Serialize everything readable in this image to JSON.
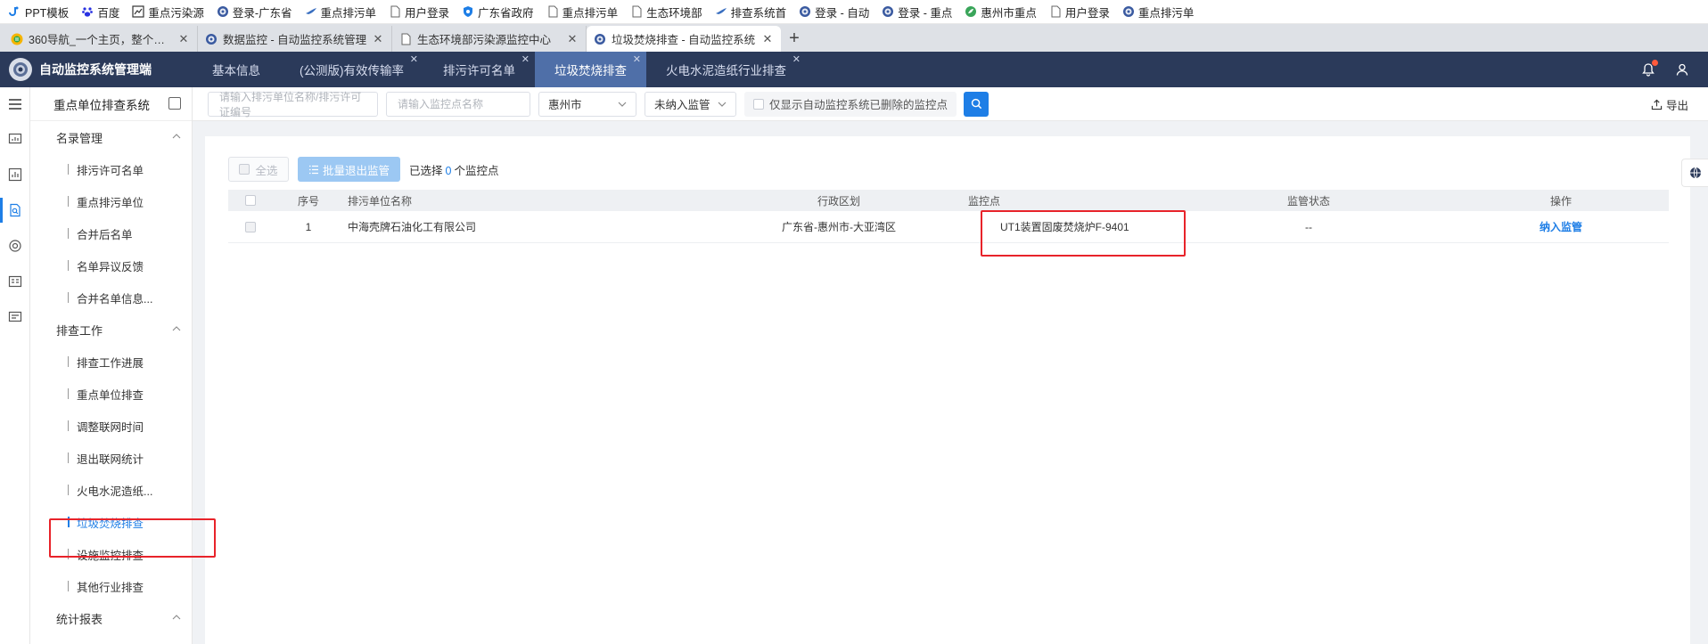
{
  "bookmarks": [
    {
      "label": "PPT模板",
      "icon": "blue-logo-icon"
    },
    {
      "label": "百度",
      "icon": "baidu-paw-icon"
    },
    {
      "label": "重点污染源",
      "icon": "chart-icon"
    },
    {
      "label": "登录-广东省",
      "icon": "emblem-icon"
    },
    {
      "label": "重点排污单",
      "icon": "bird-icon"
    },
    {
      "label": "用户登录",
      "icon": "page-icon"
    },
    {
      "label": "广东省政府",
      "icon": "shield-blue-icon"
    },
    {
      "label": "重点排污单",
      "icon": "page-icon"
    },
    {
      "label": "生态环境部",
      "icon": "page-icon"
    },
    {
      "label": "排查系统首",
      "icon": "bird-icon"
    },
    {
      "label": "登录 - 自动",
      "icon": "emblem-icon"
    },
    {
      "label": "登录 - 重点",
      "icon": "emblem-icon"
    },
    {
      "label": "惠州市重点",
      "icon": "leaf-icon"
    },
    {
      "label": "用户登录",
      "icon": "page-icon"
    },
    {
      "label": "重点排污单",
      "icon": "emblem-icon"
    }
  ],
  "tabs": [
    {
      "title": "360导航_一个主页，整个世界",
      "icon": "360-icon",
      "active": false
    },
    {
      "title": "数据监控 - 自动监控系统管理",
      "icon": "emblem-icon",
      "active": false
    },
    {
      "title": "生态环境部污染源监控中心",
      "icon": "page-icon",
      "active": false
    },
    {
      "title": "垃圾焚烧排查 - 自动监控系统",
      "icon": "emblem-icon",
      "active": true
    }
  ],
  "app": {
    "title": "自动监控系统管理端",
    "nav": [
      {
        "label": "基本信息",
        "closable": false,
        "active": false
      },
      {
        "label": "(公测版)有效传输率",
        "closable": true,
        "active": false
      },
      {
        "label": "排污许可名单",
        "closable": true,
        "active": false
      },
      {
        "label": "垃圾焚烧排查",
        "closable": true,
        "active": true
      },
      {
        "label": "火电水泥造纸行业排查",
        "closable": true,
        "active": false
      }
    ]
  },
  "sidebar": {
    "title": "重点单位排查系统",
    "groups": [
      {
        "label": "名录管理",
        "items": [
          "排污许可名单",
          "重点排污单位",
          "合并后名单",
          "名单异议反馈",
          "合并名单信息..."
        ]
      },
      {
        "label": "排查工作",
        "items": [
          "排查工作进展",
          "重点单位排查",
          "调整联网时间",
          "退出联网统计",
          "火电水泥造纸...",
          "垃圾焚烧排查",
          "设施监控排查",
          "其他行业排查"
        ]
      },
      {
        "label": "统计报表",
        "items": []
      }
    ],
    "active_item": "垃圾焚烧排查"
  },
  "filters": {
    "unit_placeholder": "请输入排污单位名称/排污许可证编号",
    "point_placeholder": "请输入监控点名称",
    "city": "惠州市",
    "status": "未纳入监管",
    "show_deleted_label": "仅显示自动监控系统已删除的监控点",
    "export_label": "导出"
  },
  "toolbar": {
    "select_all": "全选",
    "batch_exit": "批量退出监管",
    "selected_prefix": "已选择",
    "selected_count": "0",
    "selected_suffix": "个监控点"
  },
  "table": {
    "headers": {
      "index": "序号",
      "name": "排污单位名称",
      "region": "行政区划",
      "point": "监控点",
      "status": "监管状态",
      "op": "操作"
    },
    "rows": [
      {
        "index": "1",
        "name": "中海壳牌石油化工有限公司",
        "region": "广东省-惠州市-大亚湾区",
        "point": "UT1装置固废焚烧炉F-9401",
        "status": "--",
        "op": "纳入监管"
      }
    ]
  },
  "colors": {
    "header_bg": "#2b3a5a",
    "accent": "#1e7ee6",
    "highlight": "#e8232a"
  }
}
